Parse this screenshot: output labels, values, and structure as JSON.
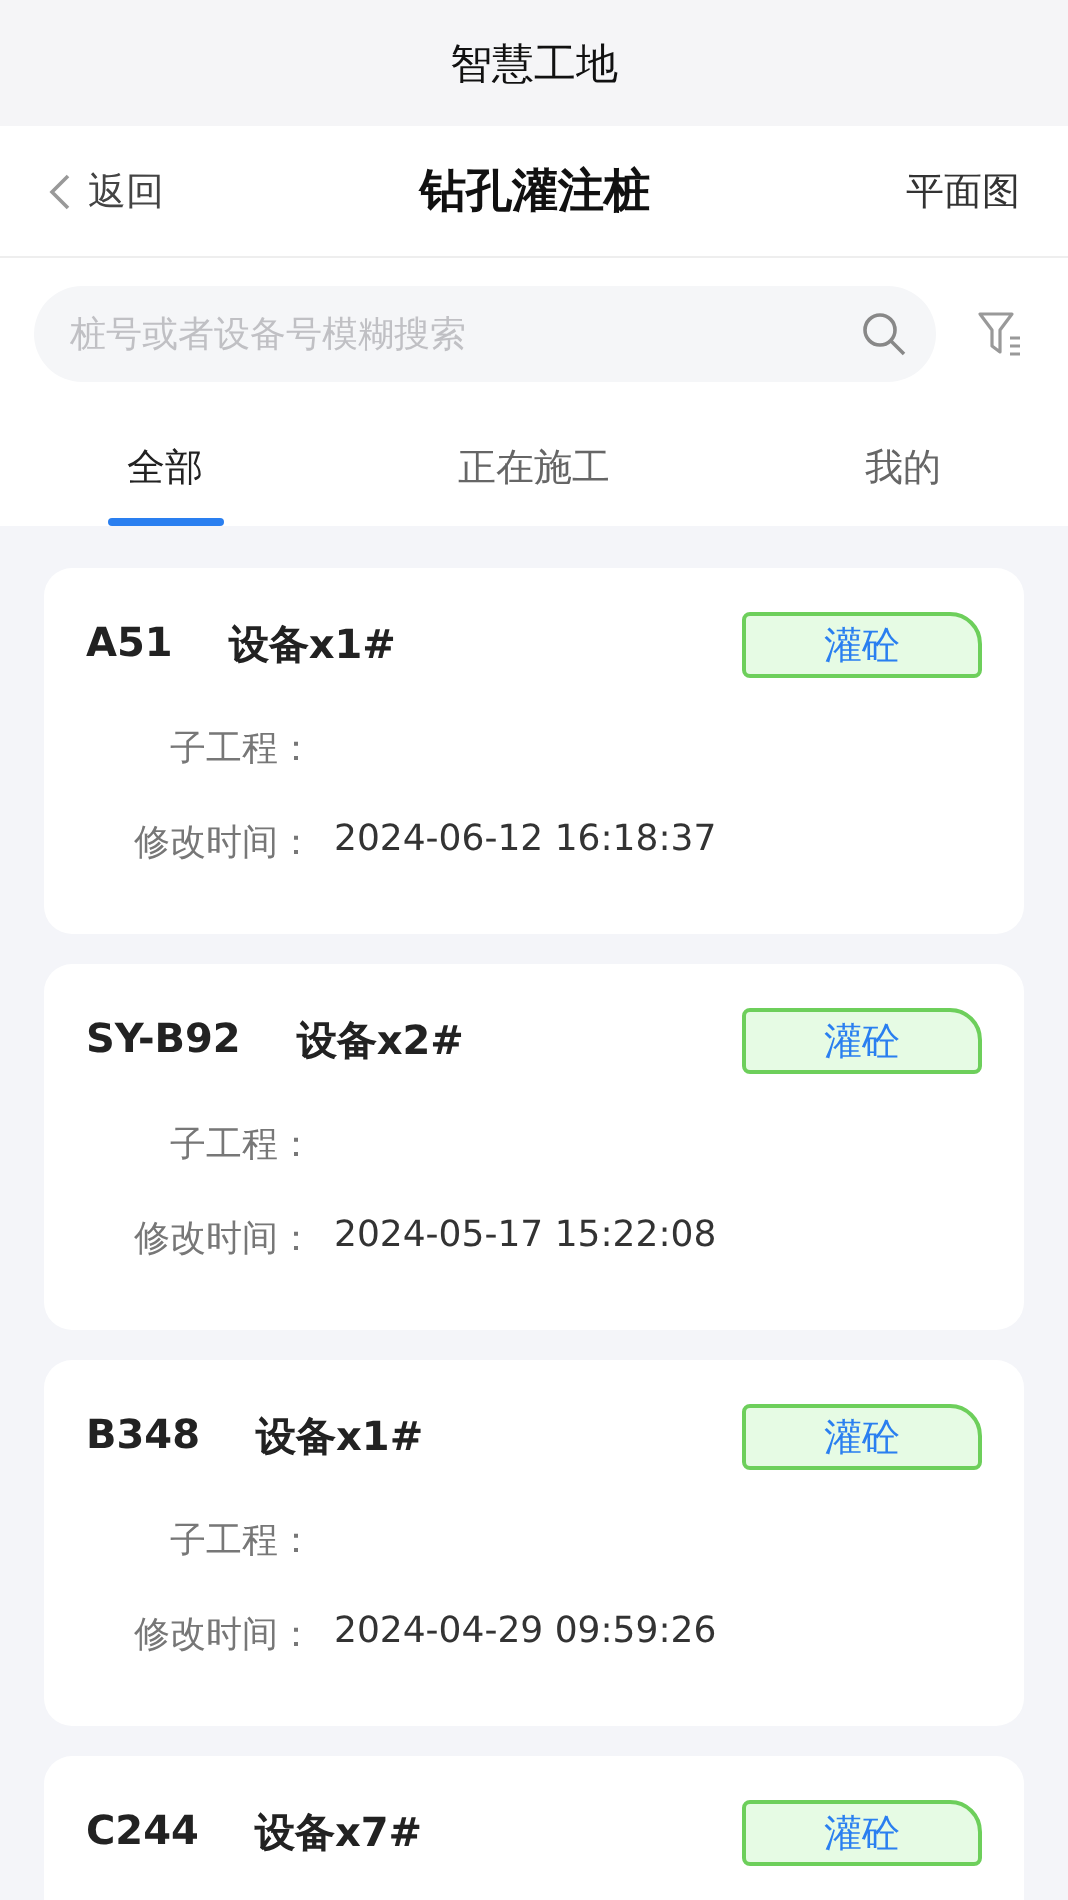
{
  "status_title": "智慧工地",
  "nav": {
    "back": "返回",
    "title": "钻孔灌注桩",
    "action": "平面图"
  },
  "search": {
    "placeholder": "桩号或者设备号模糊搜索"
  },
  "tabs": [
    {
      "label": "全部",
      "selected": true
    },
    {
      "label": "正在施工",
      "selected": false
    },
    {
      "label": "我的",
      "selected": false
    }
  ],
  "cards": [
    {
      "pile": "A51",
      "device": "设备x1#",
      "status": "灌砼",
      "fields": [
        {
          "label": "子工程："
        },
        {
          "label": "修改时间：",
          "value": "2024-06-12 16:18:37"
        }
      ]
    },
    {
      "pile": "SY-B92",
      "device": "设备x2#",
      "status": "灌砼",
      "fields": [
        {
          "label": "子工程："
        },
        {
          "label": "修改时间：",
          "value": "2024-05-17 15:22:08"
        }
      ]
    },
    {
      "pile": "B348",
      "device": "设备x1#",
      "status": "灌砼",
      "fields": [
        {
          "label": "子工程："
        },
        {
          "label": "修改时间：",
          "value": "2024-04-29 09:59:26"
        }
      ]
    },
    {
      "pile": "C244",
      "device": "设备x7#",
      "status": "灌砼"
    }
  ]
}
